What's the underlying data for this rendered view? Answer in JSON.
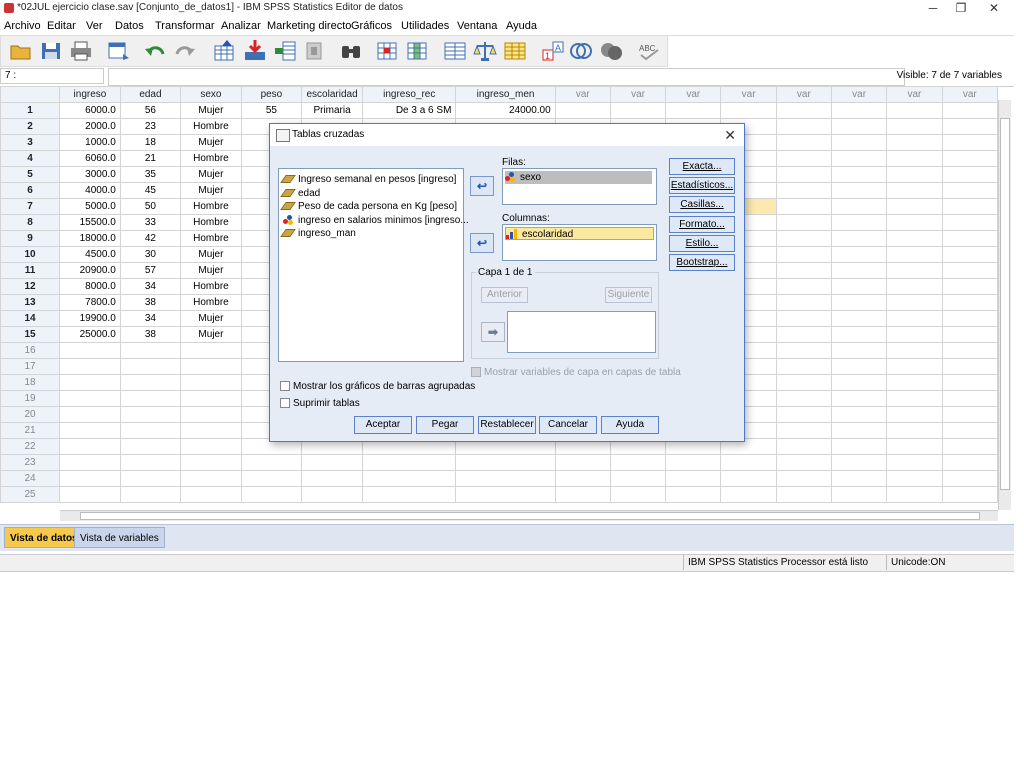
{
  "window": {
    "title": "*02JUL ejercicio clase.sav [Conjunto_de_datos1] - IBM SPSS Statistics Editor de datos",
    "minimize": "─",
    "restore": "❐",
    "close": "✕"
  },
  "menu": [
    "Archivo",
    "Editar",
    "Ver",
    "Datos",
    "Transformar",
    "Analizar",
    "Marketing directo",
    "Gráficos",
    "Utilidades",
    "Ventana",
    "Ayuda"
  ],
  "toolbar_icons": [
    "open-icon",
    "save-icon",
    "print-icon",
    "dialog-recall-icon",
    "undo-icon",
    "redo-icon",
    "goto-case-icon",
    "goto-variable-icon",
    "variables-icon",
    "run-descriptives-icon",
    "find-icon",
    "insert-cases-icon",
    "insert-variable-icon",
    "split-file-icon",
    "weight-cases-icon",
    "select-cases-icon",
    "value-labels-icon",
    "use-sets-icon",
    "show-all-variables-icon",
    "spell-check-icon"
  ],
  "refbar": {
    "cell_ref": "7 :",
    "cell_value": "",
    "visible": "Visible: 7 de 7 variables"
  },
  "grid": {
    "columns": [
      "ingreso",
      "edad",
      "sexo",
      "peso",
      "escolaridad",
      "ingreso_rec",
      "ingreso_men",
      "var",
      "var",
      "var",
      "var",
      "var",
      "var",
      "var",
      "var"
    ],
    "rows": [
      [
        "6000.0",
        "56",
        "Mujer",
        "55",
        "Primaria",
        "De 3 a 6 SM",
        "24000.00"
      ],
      [
        "2000.0",
        "23",
        "Hombre",
        "",
        "",
        "",
        ""
      ],
      [
        "1000.0",
        "18",
        "Mujer",
        "",
        "",
        "",
        ""
      ],
      [
        "6060.0",
        "21",
        "Hombre",
        "",
        "",
        "",
        ""
      ],
      [
        "3000.0",
        "35",
        "Mujer",
        "",
        "",
        "",
        ""
      ],
      [
        "4000.0",
        "45",
        "Mujer",
        "",
        "",
        "",
        ""
      ],
      [
        "5000.0",
        "50",
        "Hombre",
        "",
        "",
        "",
        ""
      ],
      [
        "15500.0",
        "33",
        "Hombre",
        "",
        "",
        "",
        ""
      ],
      [
        "18000.0",
        "42",
        "Hombre",
        "",
        "",
        "",
        ""
      ],
      [
        "4500.0",
        "30",
        "Mujer",
        "",
        "",
        "",
        ""
      ],
      [
        "20900.0",
        "57",
        "Mujer",
        "",
        "",
        "",
        ""
      ],
      [
        "8000.0",
        "34",
        "Hombre",
        "",
        "",
        "",
        ""
      ],
      [
        "7800.0",
        "38",
        "Hombre",
        "",
        "",
        "",
        ""
      ],
      [
        "19900.0",
        "34",
        "Mujer",
        "",
        "",
        "",
        ""
      ],
      [
        "25000.0",
        "38",
        "Mujer",
        "",
        "",
        "",
        ""
      ]
    ],
    "row_numbers": [
      "1",
      "2",
      "3",
      "4",
      "5",
      "6",
      "7",
      "8",
      "9",
      "10",
      "11",
      "12",
      "13",
      "14",
      "15",
      "16",
      "17",
      "18",
      "19",
      "20",
      "21",
      "22",
      "23",
      "24",
      "25"
    ],
    "selected_row": 7,
    "selected_col": 10
  },
  "tabs": {
    "data_view": "Vista de datos",
    "variable_view": "Vista de variables"
  },
  "status": {
    "processor": "IBM SPSS Statistics Processor está listo",
    "unicode": "Unicode:ON"
  },
  "dialog": {
    "title": "Tablas cruzadas",
    "close": "✕",
    "variables": [
      {
        "label": "Ingreso semanal en pesos [ingreso]",
        "type": "scale"
      },
      {
        "label": "edad",
        "type": "scale"
      },
      {
        "label": "Peso de cada persona en Kg [peso]",
        "type": "scale"
      },
      {
        "label": "ingreso en salarios minimos [ingreso...",
        "type": "nominal"
      },
      {
        "label": "ingreso_man",
        "type": "scale"
      }
    ],
    "rows_label": "Filas:",
    "rows_items": [
      "sexo"
    ],
    "columns_label": "Columnas:",
    "columns_items": [
      "escolaridad"
    ],
    "layer_label": "Capa 1 de 1",
    "previous": "Anterior",
    "next": "Siguiente",
    "layer_option": "Mostrar variables de capa en capas de tabla",
    "side_buttons": [
      "Exacta...",
      "Estadísticos...",
      "Casillas...",
      "Formato...",
      "Estilo...",
      "Bootstrap..."
    ],
    "check_bars": "Mostrar los gráficos de barras agrupadas",
    "check_suppress": "Suprimir tablas",
    "buttons": {
      "ok": "Aceptar",
      "paste": "Pegar",
      "reset": "Restablecer",
      "cancel": "Cancelar",
      "help": "Ayuda"
    }
  },
  "colors": {
    "selected_cell": "#fbe9b0",
    "active_tab": "#f6c94c",
    "dialog_border": "#4a78c9"
  }
}
